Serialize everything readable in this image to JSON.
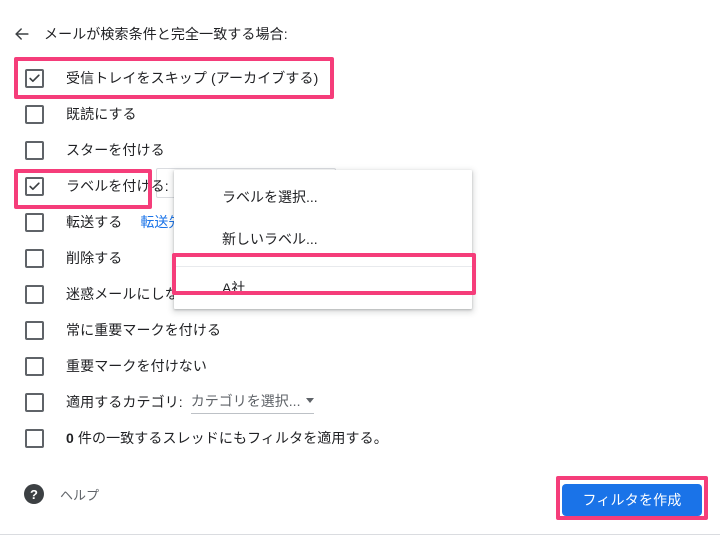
{
  "header": {
    "back_icon": "arrow-left-icon",
    "title": "メールが検索条件と完全一致する場合:"
  },
  "actions": [
    {
      "label": "受信トレイをスキップ (アーカイブする)",
      "checked": true
    },
    {
      "label": "既読にする",
      "checked": false
    },
    {
      "label": "スターを付ける",
      "checked": false
    },
    {
      "label": "ラベルを付ける:",
      "checked": true
    },
    {
      "label": "転送する",
      "checked": false,
      "link": "転送先"
    },
    {
      "label": "削除する",
      "checked": false
    },
    {
      "label": "迷惑メールにしない",
      "checked": false
    },
    {
      "label": "常に重要マークを付ける",
      "checked": false
    },
    {
      "label": "重要マークを付けない",
      "checked": false
    },
    {
      "label": "適用するカテゴリ:",
      "checked": false,
      "select_value": "カテゴリを選択..."
    },
    {
      "label_prefix": "0",
      "label_rest": " 件の一致するスレッドにもフィルタを適用する。",
      "checked": false
    }
  ],
  "label_dropdown": {
    "items": [
      {
        "label": "ラベルを選択..."
      },
      {
        "label": "新しいラベル..."
      },
      {
        "label": "A社"
      }
    ]
  },
  "footer": {
    "help_icon": "question-mark-icon",
    "help_label": "ヘルプ",
    "create_button": "フィルタを作成"
  },
  "highlights": {
    "color": "#f53d7a",
    "targets": [
      "受信トレイをスキップ (アーカイブする)",
      "ラベルを付ける:",
      "A社",
      "フィルタを作成"
    ]
  },
  "colors": {
    "accent_blue": "#1a73e8",
    "highlight_pink": "#f53d7a",
    "text_primary": "#202124",
    "text_secondary": "#5f6368"
  }
}
